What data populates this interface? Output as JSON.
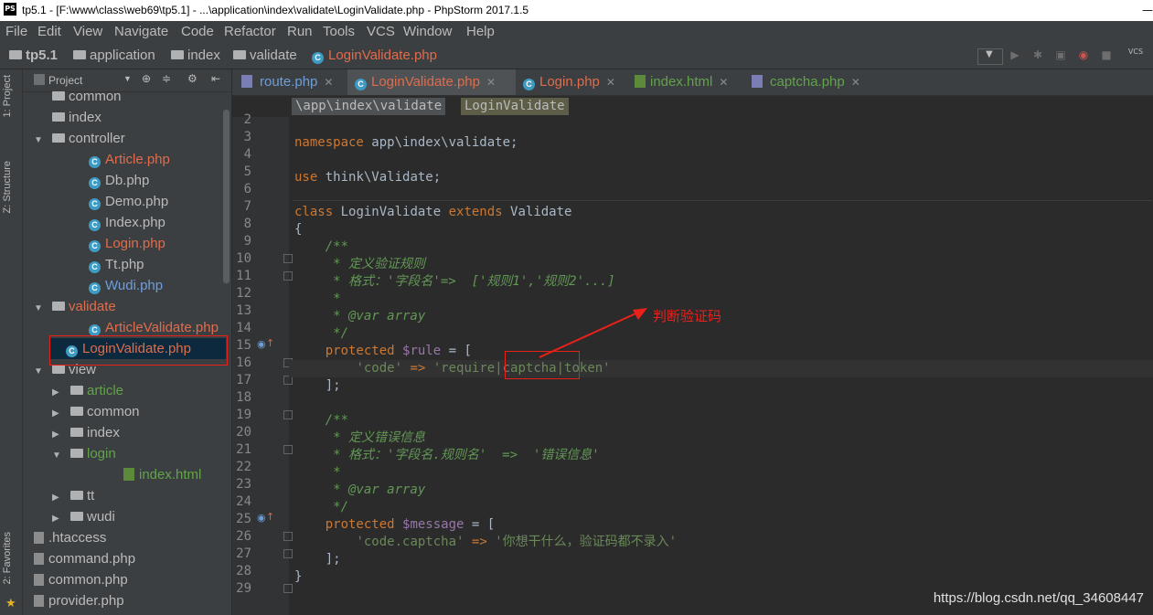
{
  "window": {
    "title": "tp5.1 - [F:\\www\\class\\web69\\tp5.1] - ...\\application\\index\\validate\\LoginValidate.php - PhpStorm 2017.1.5",
    "app_badge": "PS",
    "minimize": "—"
  },
  "menu": [
    "File",
    "Edit",
    "View",
    "Navigate",
    "Code",
    "Refactor",
    "Run",
    "Tools",
    "VCS",
    "Window",
    "Help"
  ],
  "breadcrumb": [
    {
      "label": "tp5.1",
      "icon": "folder-icon"
    },
    {
      "label": "application",
      "icon": "folder-icon"
    },
    {
      "label": "index",
      "icon": "folder-icon"
    },
    {
      "label": "validate",
      "icon": "folder-icon"
    },
    {
      "label": "LoginValidate.php",
      "icon": "php-class-icon",
      "current": true
    }
  ],
  "toolbar": {
    "vcs_label": "VCS"
  },
  "side_tabs": {
    "project": "1: Project",
    "structure": "Z: Structure",
    "favorites": "2: Favorites"
  },
  "project_panel": {
    "header": "Project",
    "items": [
      {
        "label": "common",
        "indent": 1,
        "type": "folder",
        "arrow": ""
      },
      {
        "label": "index",
        "indent": 1,
        "type": "folder",
        "arrow": ""
      },
      {
        "label": "controller",
        "indent": 1,
        "type": "folder",
        "arrow": "▼"
      },
      {
        "label": "Article.php",
        "indent": 2,
        "type": "php",
        "color": "red"
      },
      {
        "label": "Db.php",
        "indent": 2,
        "type": "php",
        "color": "normal"
      },
      {
        "label": "Demo.php",
        "indent": 2,
        "type": "php",
        "color": "normal"
      },
      {
        "label": "Index.php",
        "indent": 2,
        "type": "php",
        "color": "normal"
      },
      {
        "label": "Login.php",
        "indent": 2,
        "type": "php",
        "color": "red"
      },
      {
        "label": "Tt.php",
        "indent": 2,
        "type": "php",
        "color": "normal"
      },
      {
        "label": "Wudi.php",
        "indent": 2,
        "type": "php",
        "color": "blue"
      },
      {
        "label": "validate",
        "indent": 1,
        "type": "folder",
        "arrow": "▼",
        "color": "red"
      },
      {
        "label": "ArticleValidate.php",
        "indent": 2,
        "type": "php",
        "color": "red"
      },
      {
        "label": "LoginValidate.php",
        "indent": 2,
        "type": "php",
        "color": "red",
        "selected": true
      },
      {
        "label": "view",
        "indent": 1,
        "type": "folder",
        "arrow": "▼"
      },
      {
        "label": "article",
        "indent": 2,
        "type": "folder",
        "arrow": "▶",
        "color": "green"
      },
      {
        "label": "common",
        "indent": 2,
        "type": "folder",
        "arrow": "▶"
      },
      {
        "label": "index",
        "indent": 2,
        "type": "folder",
        "arrow": "▶"
      },
      {
        "label": "login",
        "indent": 2,
        "type": "folder",
        "arrow": "▼",
        "color": "green"
      },
      {
        "label": "index.html",
        "indent": 3,
        "type": "html",
        "color": "green"
      },
      {
        "label": "tt",
        "indent": 2,
        "type": "folder",
        "arrow": "▶"
      },
      {
        "label": "wudi",
        "indent": 2,
        "type": "folder",
        "arrow": "▶"
      },
      {
        "label": ".htaccess",
        "indent": 0,
        "type": "file"
      },
      {
        "label": "command.php",
        "indent": 0,
        "type": "file"
      },
      {
        "label": "common.php",
        "indent": 0,
        "type": "file"
      },
      {
        "label": "provider.php",
        "indent": 0,
        "type": "file"
      }
    ]
  },
  "tabs": [
    {
      "label": "route.php",
      "icon": "php-file-icon",
      "color": "blue",
      "active": false
    },
    {
      "label": "LoginValidate.php",
      "icon": "php-class-icon",
      "color": "red",
      "active": true
    },
    {
      "label": "Login.php",
      "icon": "php-class-icon",
      "color": "red",
      "active": false
    },
    {
      "label": "index.html",
      "icon": "html-file-icon",
      "color": "green",
      "active": false
    },
    {
      "label": "captcha.php",
      "icon": "php-file-icon",
      "color": "green",
      "active": false
    }
  ],
  "namespace_crumbs": [
    "\\app\\index\\validate",
    "LoginValidate"
  ],
  "code": {
    "line_numbers": [
      "2",
      "3",
      "4",
      "5",
      "6",
      "7",
      "8",
      "9",
      "10",
      "11",
      "12",
      "13",
      "14",
      "15",
      "16",
      "17",
      "18",
      "19",
      "20",
      "21",
      "22",
      "23",
      "24",
      "25",
      "26",
      "27",
      "28",
      "29"
    ],
    "current_line": "16"
  },
  "annotation": {
    "text": "判断验证码"
  },
  "watermark": "https://blog.csdn.net/qq_34608447"
}
